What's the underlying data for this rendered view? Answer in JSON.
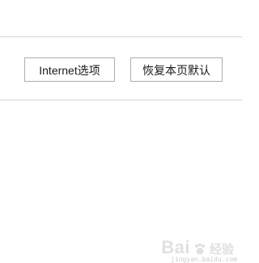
{
  "buttons": {
    "internet_options": "Internet选项",
    "restore_defaults": "恢复本页默认"
  },
  "watermark": {
    "logo_text": "Bai",
    "logo_text_2": "经验",
    "url": "jingyan.baidu.com"
  },
  "colors": {
    "background": "#ffffff",
    "divider": "#d4d4d4",
    "button_border": "#adadad",
    "button_text": "#1a1a1a"
  }
}
